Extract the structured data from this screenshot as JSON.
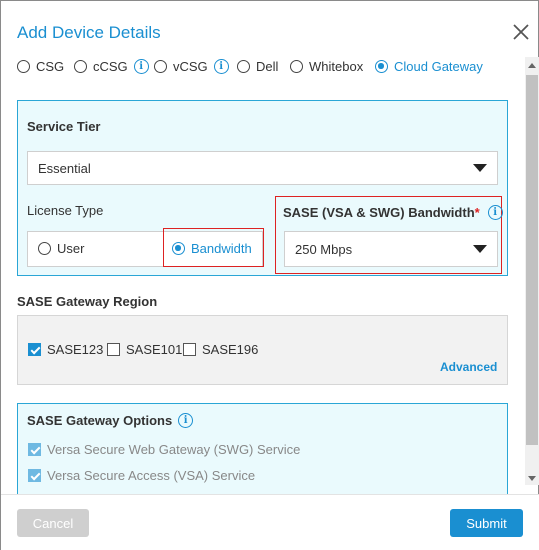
{
  "dialog": {
    "title": "Add Device Details"
  },
  "device_types": [
    {
      "label": "CSG",
      "selected": false,
      "info": false
    },
    {
      "label": "cCSG",
      "selected": false,
      "info": true
    },
    {
      "label": "vCSG",
      "selected": false,
      "info": true
    },
    {
      "label": "Dell",
      "selected": false,
      "info": false
    },
    {
      "label": "Whitebox",
      "selected": false,
      "info": false
    },
    {
      "label": "Cloud Gateway",
      "selected": true,
      "info": false
    }
  ],
  "service_tier": {
    "label": "Service Tier",
    "value": "Essential"
  },
  "license_type": {
    "label": "License Type",
    "options": [
      {
        "label": "User",
        "selected": false
      },
      {
        "label": "Bandwidth",
        "selected": true
      }
    ]
  },
  "bandwidth": {
    "label": "SASE (VSA & SWG) Bandwidth",
    "required_mark": "*",
    "value": "250 Mbps"
  },
  "gateway_region": {
    "label": "SASE Gateway Region",
    "options": [
      {
        "label": "SASE123",
        "checked": true
      },
      {
        "label": "SASE101",
        "checked": false
      },
      {
        "label": "SASE196",
        "checked": false
      }
    ],
    "advanced_link": "Advanced"
  },
  "gateway_options": {
    "label": "SASE Gateway Options",
    "options": [
      {
        "label": "Versa Secure Web Gateway (SWG) Service",
        "checked": true,
        "disabled": true
      },
      {
        "label": "Versa Secure Access (VSA) Service",
        "checked": true,
        "disabled": true
      }
    ]
  },
  "footer": {
    "cancel_label": "Cancel",
    "submit_label": "Submit"
  },
  "colors": {
    "accent": "#1a8fd1",
    "panel_bg": "#eafafd",
    "panel_border": "#2aa6d6",
    "highlight_border": "#dd2222"
  }
}
